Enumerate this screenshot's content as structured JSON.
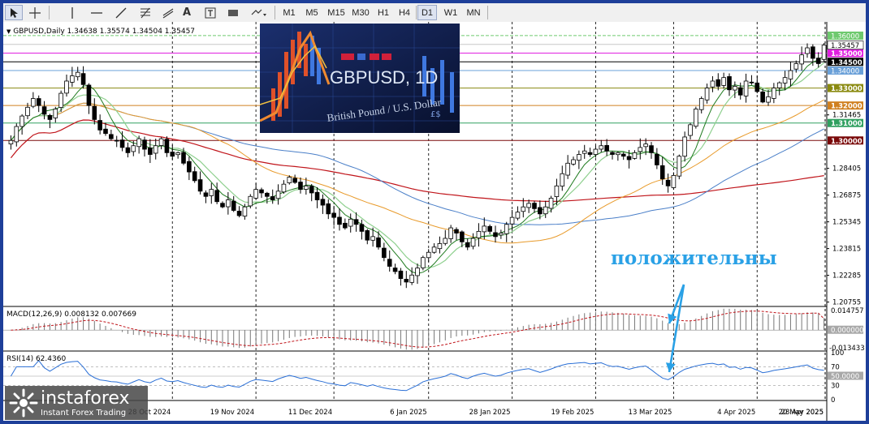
{
  "toolbar": {
    "tools": [
      "cursor-icon",
      "crosshair-icon",
      "vertical-line-icon",
      "horizontal-line-icon",
      "trendline-icon",
      "fibonacci-icon",
      "channel-icon",
      "text-icon",
      "text-label-icon",
      "rectangle-icon",
      "arrows-icon"
    ],
    "text_tool_label": "A",
    "timeframes": [
      "M1",
      "M5",
      "M15",
      "M30",
      "H1",
      "H4",
      "D1",
      "W1",
      "MN"
    ],
    "active_timeframe": "D1"
  },
  "chart_header": "GBPUSD,Daily  1.34638 1.35574 1.34504 1.35457",
  "overlay_image": {
    "title": "GBPUSD, 1D",
    "subtitle": "British Pound / U.S. Dollar",
    "ticker_text": "£$"
  },
  "annotation": {
    "text": "положительны",
    "color": "#2aa1e6"
  },
  "watermark": {
    "name": "instaforex",
    "tagline": "Instant Forex Trading"
  },
  "colors": {
    "candle_up": "#000000",
    "candle_down": "#000000",
    "ma_fast": "#1e7a1e",
    "ma_fast_light": "#8fd08f",
    "ma_mid": "#e89a2a",
    "ma_slow": "#4a7fc8",
    "ma_long": "#c0141a",
    "macd_signal": "#c0141a",
    "rsi_line": "#2a6fd6",
    "annotation_arrow": "#2aa1e6"
  },
  "chart_data": {
    "type": "candlestick",
    "symbol": "GBPUSD",
    "timeframe": "Daily",
    "ohlc_last": {
      "open": 1.34638,
      "high": 1.35574,
      "low": 1.34504,
      "close": 1.35457
    },
    "x_tick_labels": [
      "28 Oct 2024",
      "19 Nov 2024",
      "11 Dec 2024",
      "6 Jan 2025",
      "28 Jan 2025",
      "19 Feb 2025",
      "13 Mar 2025",
      "4 Apr 2025",
      "28 Apr 2025",
      "20 May 2025"
    ],
    "y_tick_labels": [
      "1.35457",
      "1.31465",
      "1.28405",
      "1.26875",
      "1.25345",
      "1.23815",
      "1.22285",
      "1.20755"
    ],
    "ylim": [
      1.2055,
      1.366
    ],
    "close_path": [
      1.3,
      1.308,
      1.314,
      1.319,
      1.324,
      1.32,
      1.315,
      1.312,
      1.318,
      1.327,
      1.334,
      1.337,
      1.339,
      1.332,
      1.32,
      1.312,
      1.306,
      1.304,
      1.301,
      1.3,
      1.296,
      1.293,
      1.297,
      1.301,
      1.295,
      1.292,
      1.297,
      1.301,
      1.293,
      1.291,
      1.293,
      1.287,
      1.282,
      1.277,
      1.271,
      1.268,
      1.272,
      1.265,
      1.262,
      1.266,
      1.26,
      1.257,
      1.262,
      1.268,
      1.272,
      1.27,
      1.268,
      1.266,
      1.271,
      1.275,
      1.279,
      1.276,
      1.272,
      1.274,
      1.27,
      1.266,
      1.263,
      1.258,
      1.256,
      1.252,
      1.25,
      1.255,
      1.252,
      1.248,
      1.243,
      1.245,
      1.239,
      1.233,
      1.228,
      1.225,
      1.221,
      1.219,
      1.223,
      1.227,
      1.233,
      1.236,
      1.239,
      1.241,
      1.244,
      1.25,
      1.247,
      1.242,
      1.239,
      1.244,
      1.248,
      1.251,
      1.248,
      1.245,
      1.247,
      1.252,
      1.256,
      1.259,
      1.262,
      1.264,
      1.261,
      1.258,
      1.262,
      1.267,
      1.274,
      1.281,
      1.287,
      1.289,
      1.292,
      1.294,
      1.292,
      1.295,
      1.297,
      1.294,
      1.292,
      1.293,
      1.291,
      1.289,
      1.293,
      1.296,
      1.298,
      1.293,
      1.286,
      1.278,
      1.274,
      1.28,
      1.291,
      1.302,
      1.309,
      1.318,
      1.324,
      1.33,
      1.334,
      1.331,
      1.336,
      1.329,
      1.331,
      1.326,
      1.334,
      1.333,
      1.328,
      1.322,
      1.325,
      1.33,
      1.333,
      1.336,
      1.34,
      1.344,
      1.349,
      1.353,
      1.347,
      1.344,
      1.354
    ],
    "horizontal_levels": [
      {
        "price": 1.36,
        "label": "1.36000",
        "box_color": "#6ec96e"
      },
      {
        "price": 1.355,
        "label": "1.35500",
        "box_color": "#e8e8e8"
      },
      {
        "price": 1.35,
        "label": "1.35000",
        "box_color": "#e020e0"
      },
      {
        "price": 1.345,
        "label": "1.34500",
        "box_color": "#000000"
      },
      {
        "price": 1.34,
        "label": "1.34000",
        "box_color": "#6aa0d8"
      },
      {
        "price": 1.33,
        "label": "1.33000",
        "box_color": "#8a8a10"
      },
      {
        "price": 1.32,
        "label": "1.32000",
        "box_color": "#d08020"
      },
      {
        "price": 1.31,
        "label": "1.31000",
        "box_color": "#30a060"
      },
      {
        "price": 1.3,
        "label": "1.30000",
        "box_color": "#7a0a0a"
      }
    ],
    "macd": {
      "label": "MACD(12,26,9) 0.008132 0.007669",
      "fast": 12,
      "slow": 26,
      "signal": 9,
      "value": 0.008132,
      "signal_value": 0.007669,
      "ylim": [
        -0.013433,
        0.014757
      ],
      "y_tick_labels": [
        "0.014757",
        "0.000000",
        "-0.013433"
      ]
    },
    "rsi": {
      "label": "RSI(14) 62.4360",
      "period": 14,
      "value": 62.436,
      "ylim": [
        0,
        100
      ],
      "y_tick_labels": [
        "100",
        "70",
        "50.0000",
        "30",
        "0"
      ]
    }
  }
}
